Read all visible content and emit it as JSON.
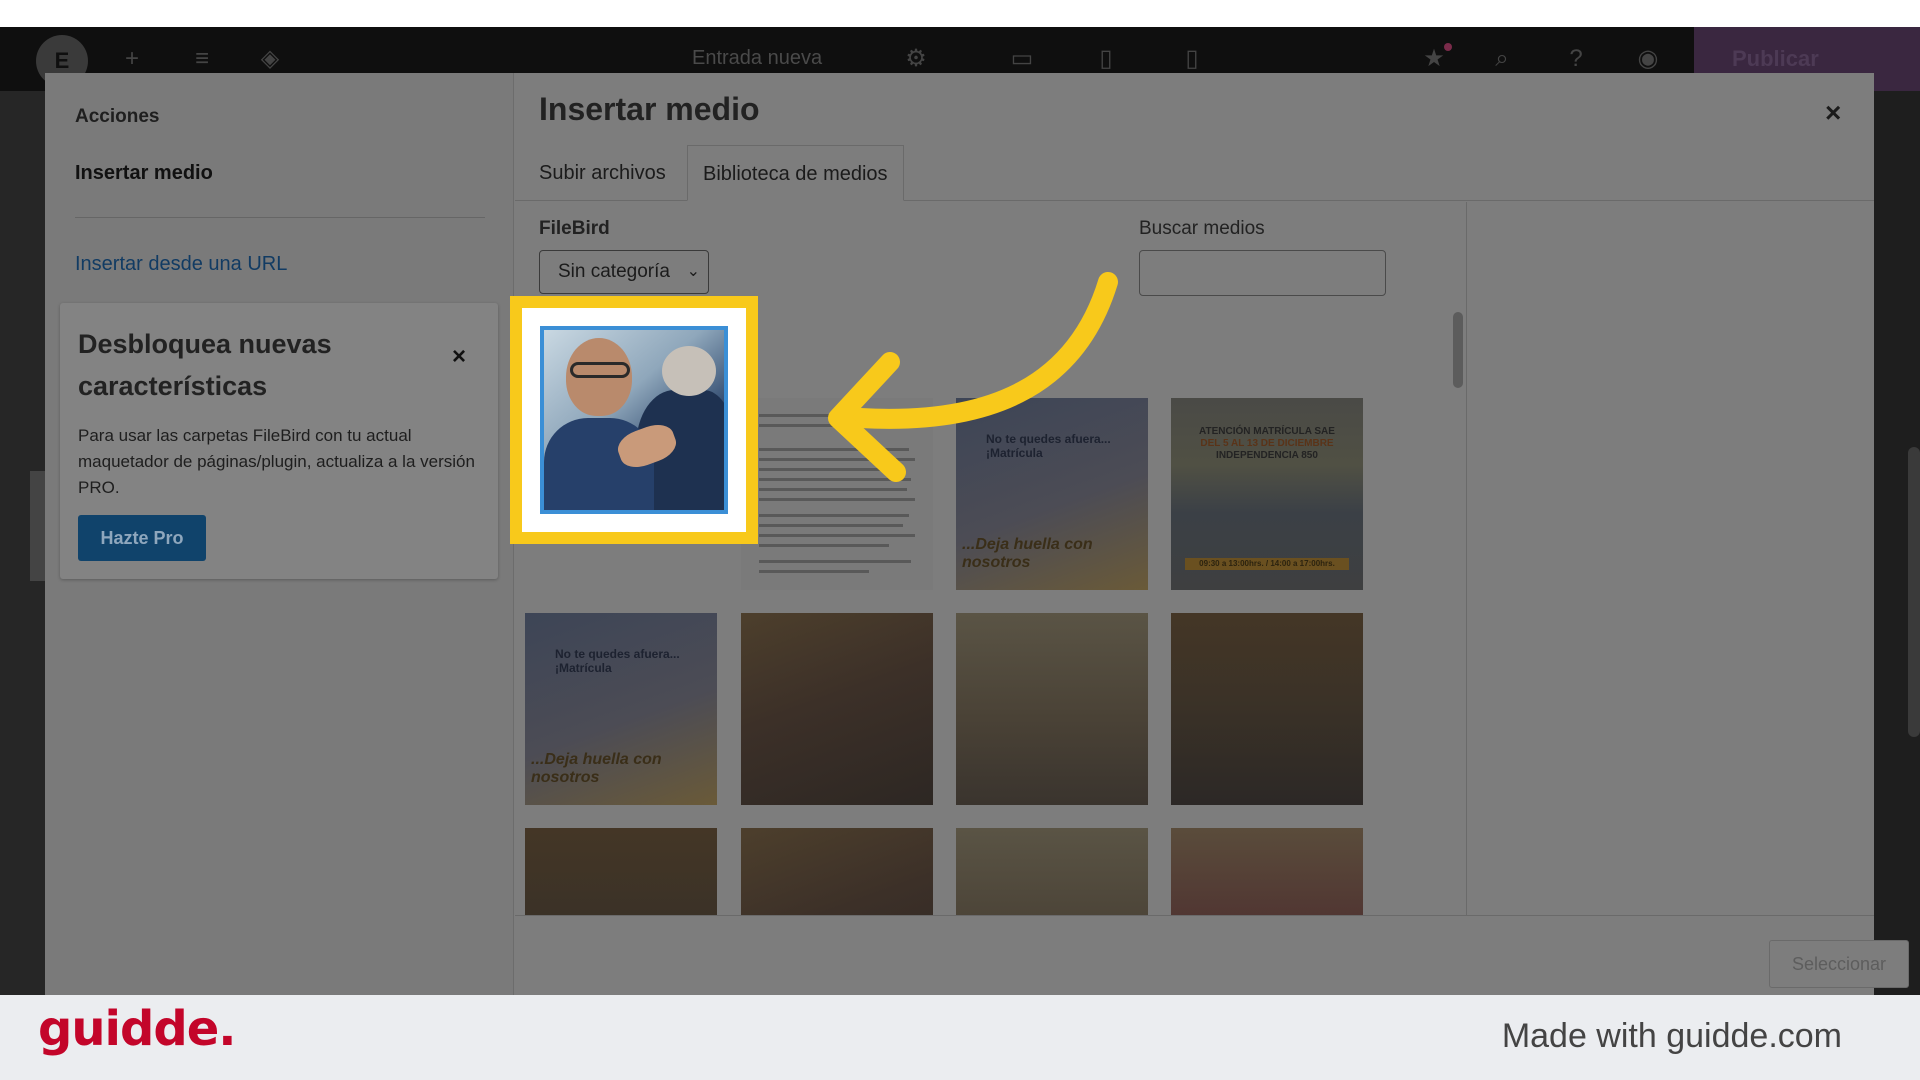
{
  "editor": {
    "logo_text": "E",
    "title": "Entrada nueva",
    "publish_label": "Publicar"
  },
  "modal": {
    "title": "Insertar medio",
    "close_glyph": "×",
    "sidebar": {
      "heading": "Acciones",
      "active_item": "Insertar medio",
      "url_link": "Insertar desde una URL"
    },
    "promo": {
      "title": "Desbloquea nuevas características",
      "close_glyph": "×",
      "text": "Para usar las carpetas FileBird con tu actual maquetador de páginas/plugin, actualiza a la versión PRO.",
      "button": "Hazte Pro"
    },
    "tabs": [
      {
        "label": "Subir archivos"
      },
      {
        "label": "Biblioteca de medios"
      }
    ],
    "filebird_label": "FileBird",
    "filebird_select": "Sin categoría",
    "search_label": "Buscar medios",
    "search_value": "",
    "thumb_texts": {
      "promo_tagline": "No te quedes afuera...¡Matrícula",
      "promo_caption": "...Deja huella con nosotros",
      "banner_heading": "ATENCIÓN MATRÍCULA SAE",
      "banner_dates": "DEL 5 AL 13 DE DICIEMBRE",
      "banner_address": "INDEPENDENCIA 850",
      "banner_hours": "09:30 a 13:00hrs. / 14:00 a 17:00hrs."
    },
    "select_button": "Seleccionar"
  },
  "branding": {
    "logo": "guidde.",
    "made_with": "Made with guidde.com"
  },
  "colors": {
    "highlight": "#f8c91b",
    "brand_red": "#c3052a",
    "selection_blue": "#3b8fd6",
    "promo_button": "#10436b"
  }
}
